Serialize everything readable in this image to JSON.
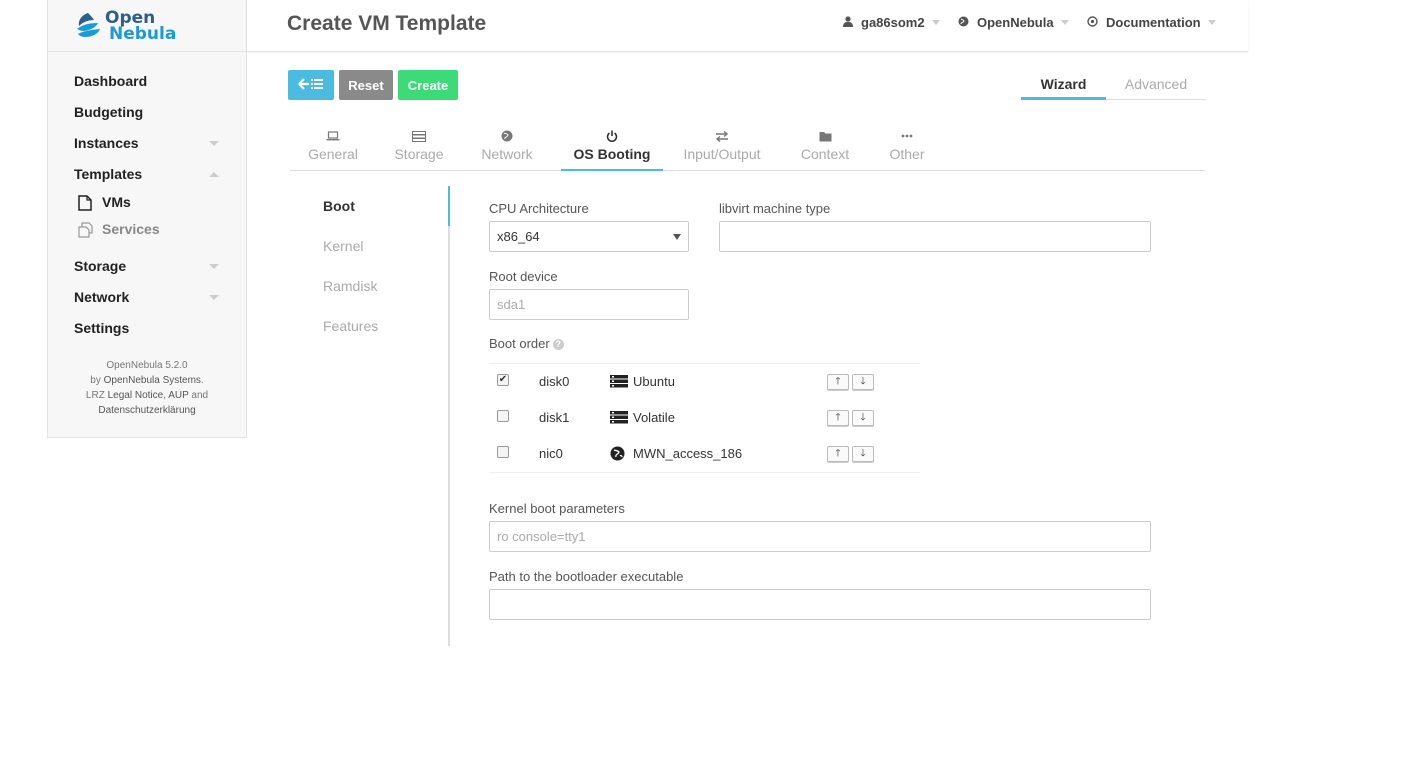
{
  "brand": {
    "line1": "Open",
    "line2": "Nebula"
  },
  "sidebar": {
    "items": [
      {
        "label": "Dashboard"
      },
      {
        "label": "Budgeting"
      },
      {
        "label": "Instances"
      },
      {
        "label": "Templates"
      },
      {
        "label": "Storage"
      },
      {
        "label": "Network"
      },
      {
        "label": "Settings"
      }
    ],
    "sub_items": [
      {
        "label": "VMs",
        "icon": "file-icon"
      },
      {
        "label": "Services",
        "icon": "services-icon"
      }
    ],
    "footer": {
      "version": "OpenNebula 5.2.0",
      "by": "by",
      "by_link": "OpenNebula Systems",
      "period": ".",
      "lrz": "LRZ",
      "legal": "Legal Notice",
      "comma": ",",
      "aup": "AUP",
      "and": "and",
      "privacy": "Datenschutzerklärung"
    }
  },
  "header": {
    "title": "Create VM Template",
    "user": "ga86som2",
    "zone": "OpenNebula",
    "docs": "Documentation"
  },
  "toolbar": {
    "reset": "Reset",
    "create": "Create",
    "wizard": "Wizard",
    "advanced": "Advanced"
  },
  "tabs": [
    {
      "label": "General",
      "icon": "laptop-icon"
    },
    {
      "label": "Storage",
      "icon": "storage-icon"
    },
    {
      "label": "Network",
      "icon": "globe-icon"
    },
    {
      "label": "OS Booting",
      "icon": "power-icon"
    },
    {
      "label": "Input/Output",
      "icon": "exchange-icon"
    },
    {
      "label": "Context",
      "icon": "folder-icon"
    },
    {
      "label": "Other",
      "icon": "ellipsis-icon"
    }
  ],
  "subnav": [
    "Boot",
    "Kernel",
    "Ramdisk",
    "Features"
  ],
  "form": {
    "cpu_arch_label": "CPU Architecture",
    "cpu_arch_value": "x86_64",
    "machine_type_label": "libvirt machine type",
    "machine_type_value": "",
    "root_device_label": "Root device",
    "root_device_placeholder": "sda1",
    "boot_order_label": "Boot order",
    "kernel_params_label": "Kernel boot parameters",
    "kernel_params_placeholder": "ro console=tty1",
    "bootloader_label": "Path to the bootloader executable",
    "bootloader_value": ""
  },
  "boot_order": [
    {
      "id": "disk0",
      "name": "Ubuntu",
      "checked": true,
      "icon": "storage-icon"
    },
    {
      "id": "disk1",
      "name": "Volatile",
      "checked": false,
      "icon": "storage-icon"
    },
    {
      "id": "nic0",
      "name": "MWN_access_186",
      "checked": false,
      "icon": "globe-icon"
    }
  ],
  "colors": {
    "accent": "#4cbbe0",
    "reset": "#8a8a8a",
    "create": "#3ddb78"
  }
}
